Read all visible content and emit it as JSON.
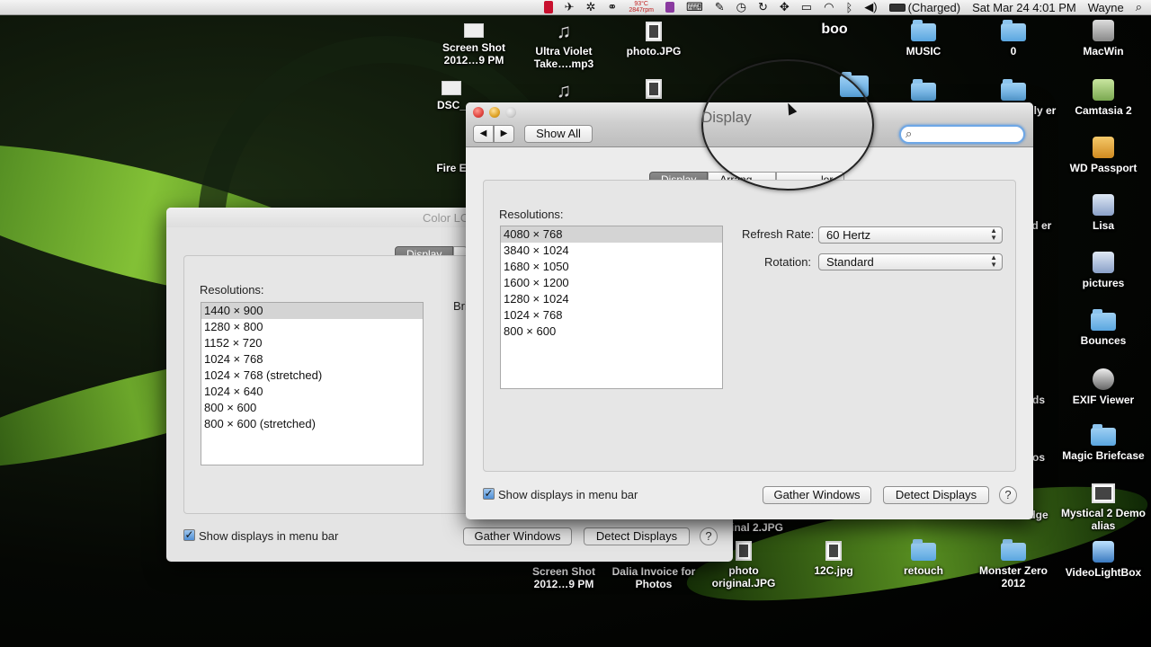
{
  "menubar": {
    "temp_line1": "93°C",
    "temp_line2": "2847rpm",
    "battery": "(Charged)",
    "datetime": "Sat Mar 24  4:01 PM",
    "user": "Wayne"
  },
  "desktop_icons": {
    "screen_shot_top": "Screen Shot 2012…9 PM",
    "ultra_violet": "Ultra Violet Take….mp3",
    "photo_jpg": "photo.JPG",
    "book_partial": "boo",
    "music": "MUSIC",
    "zero": "0",
    "macwin": "MacWin",
    "dsc_partial": "DSC_",
    "ally_partial": "ally er",
    "camtasia": "Camtasia 2",
    "fire_partial": "Fire E",
    "wd_passport": "WD Passport",
    "ed_partial": "ed er",
    "lisa": "Lisa",
    "pictures": "pictures",
    "bounces": "Bounces",
    "ds_partial": "ds",
    "exif": "EXIF Viewer",
    "os_partial": "os",
    "magic_briefcase": "Magic Briefcase",
    "dge_partial": "dge",
    "mystical": "Mystical 2 Demo alias",
    "original2_partial": "inal 2.JPG",
    "screen_shot_bottom": "Screen Shot 2012…9 PM",
    "dalia": "Dalia Invoice for Photos",
    "photo_original": "photo original.JPG",
    "twelve_c": "12C.jpg",
    "retouch": "retouch",
    "monster_zero": "Monster Zero 2012",
    "videolightbox": "VideoLightBox"
  },
  "back_window": {
    "title": "Color LC",
    "tab_display": "Display",
    "resolutions_label": "Resolutions:",
    "resolutions": [
      "1440 × 900",
      "1280 × 800",
      "1152 × 720",
      "1024 × 768",
      "1024 × 768 (stretched)",
      "1024 × 640",
      "800 × 600",
      "800 × 600 (stretched)"
    ],
    "brightness_partial": "Bri",
    "show_displays": "Show displays in menu bar",
    "gather_windows": "Gather Windows",
    "detect_displays": "Detect Displays",
    "help": "?"
  },
  "front_window": {
    "title": "Display",
    "show_all": "Show All",
    "search_placeholder": "",
    "tabs": [
      "Display",
      "Arrang",
      "lor"
    ],
    "resolutions_label": "Resolutions:",
    "resolutions": [
      "4080 × 768",
      "3840 × 1024",
      "1680 × 1050",
      "1600 × 1200",
      "1280 × 1024",
      "1024 × 768",
      "800 × 600"
    ],
    "refresh_rate_label": "Refresh Rate:",
    "refresh_rate_value": "60 Hertz",
    "rotation_label": "Rotation:",
    "rotation_value": "Standard",
    "show_displays": "Show displays in menu bar",
    "gather_windows": "Gather Windows",
    "detect_displays": "Detect Displays",
    "help": "?"
  },
  "colors": {
    "close": "#e0443e",
    "minimize": "#dea123",
    "zoom_inactive": "#cfcfcf",
    "focus_ring": "#6ea7e6",
    "selected_tab": "#7a7a7a",
    "folder": "#5aa6e0"
  }
}
